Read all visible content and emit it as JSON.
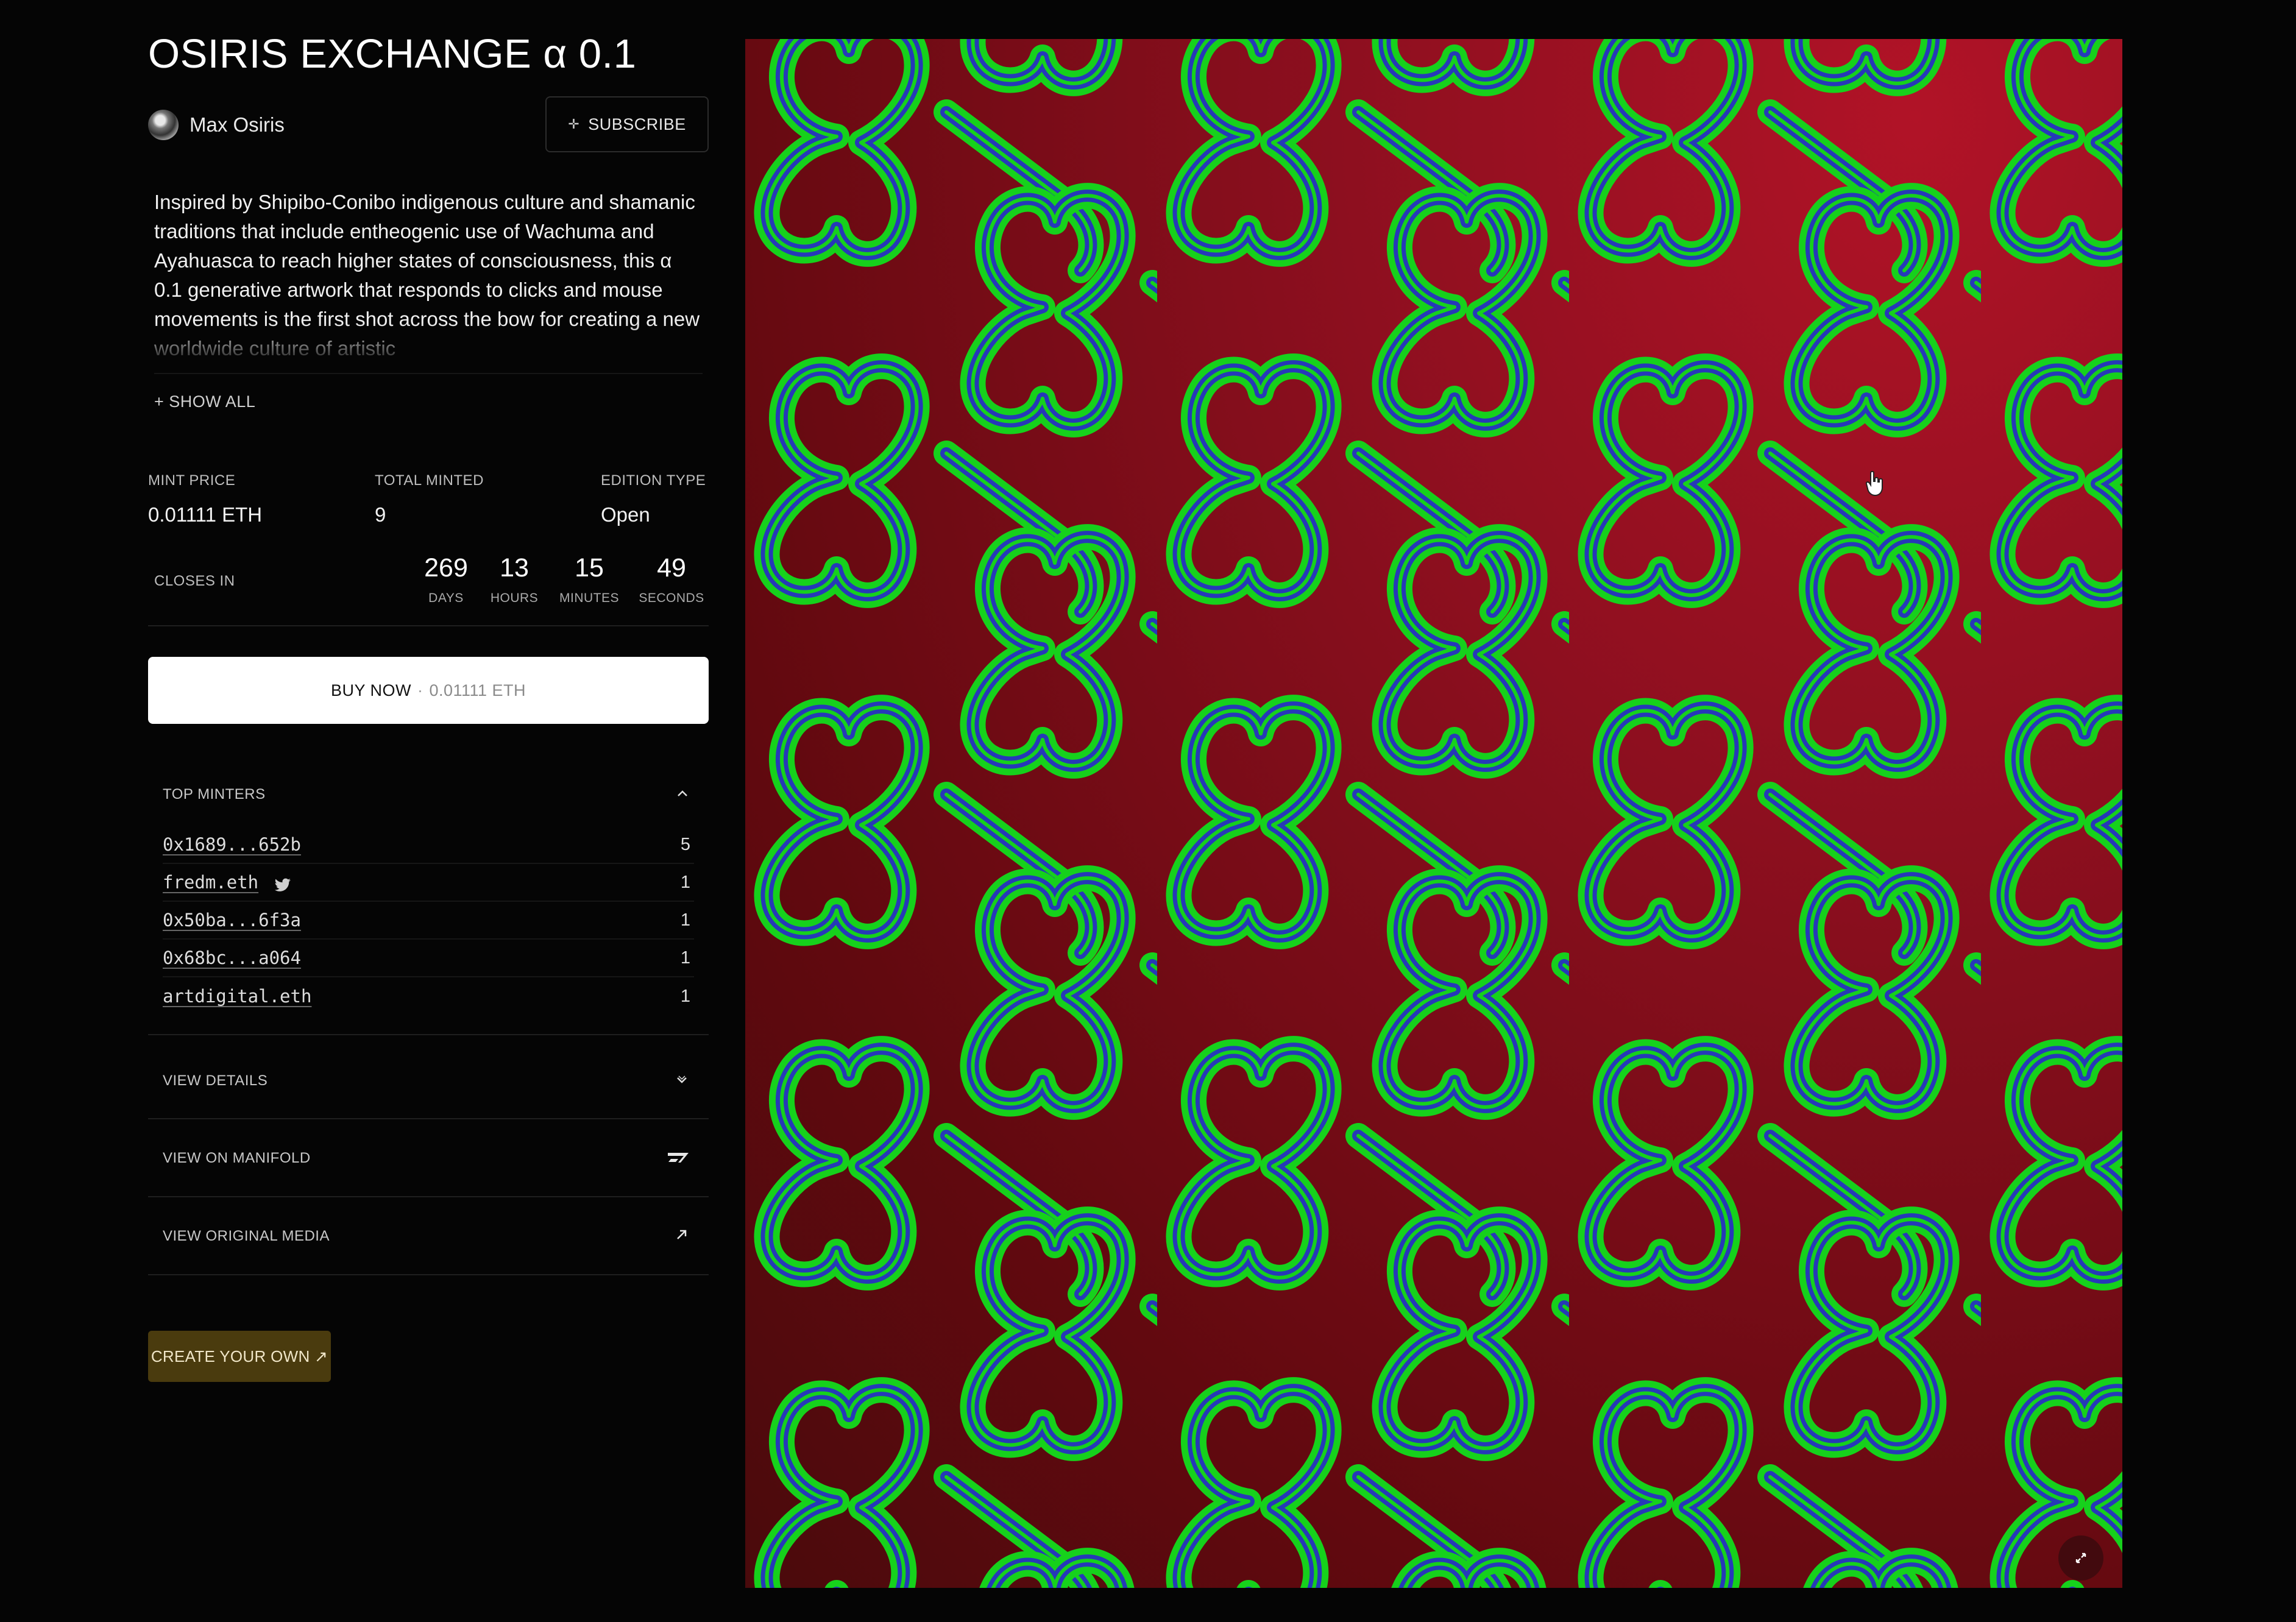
{
  "title": "OSIRIS EXCHANGE α 0.1",
  "artist": {
    "name": "Max Osiris"
  },
  "subscribe_label": "SUBSCRIBE",
  "description": "Inspired by Shipibo-Conibo indigenous culture and shamanic traditions that include entheogenic use of Wachuma and Ayahuasca to reach higher states of consciousness, this α 0.1 generative artwork that responds to clicks and mouse movements is the first shot across the bow for creating a new worldwide culture of artistic",
  "show_all_label": "+ SHOW ALL",
  "stats": {
    "mint_price_label": "MINT PRICE",
    "mint_price_value": "0.01111 ETH",
    "total_minted_label": "TOTAL MINTED",
    "total_minted_value": "9",
    "edition_type_label": "EDITION TYPE",
    "edition_type_value": "Open"
  },
  "countdown": {
    "label": "CLOSES IN",
    "days": "269",
    "days_label": "DAYS",
    "hours": "13",
    "hours_label": "HOURS",
    "minutes": "15",
    "minutes_label": "MINUTES",
    "seconds": "49",
    "seconds_label": "SECONDS"
  },
  "buy": {
    "label": "BUY NOW",
    "separator": "·",
    "price": "0.01111 ETH"
  },
  "top_minters": {
    "title": "TOP MINTERS",
    "rows": [
      {
        "name": "0x1689...652b",
        "count": "5"
      },
      {
        "name": "fredm.eth",
        "count": "1",
        "twitter": true
      },
      {
        "name": "0x50ba...6f3a",
        "count": "1"
      },
      {
        "name": "0x68bc...a064",
        "count": "1"
      },
      {
        "name": "artdigital.eth",
        "count": "1"
      }
    ]
  },
  "links": {
    "view_details": "VIEW DETAILS",
    "view_on_manifold": "VIEW ON MANIFOLD",
    "view_original_media": "VIEW ORIGINAL MEDIA"
  },
  "create_label": "CREATE YOUR OWN ↗",
  "colors": {
    "background": "#050505",
    "art_red": "#8d0f1f",
    "art_green": "#1fd01f",
    "art_blue": "#2a37c4",
    "create_bg": "#4a3b0e"
  }
}
